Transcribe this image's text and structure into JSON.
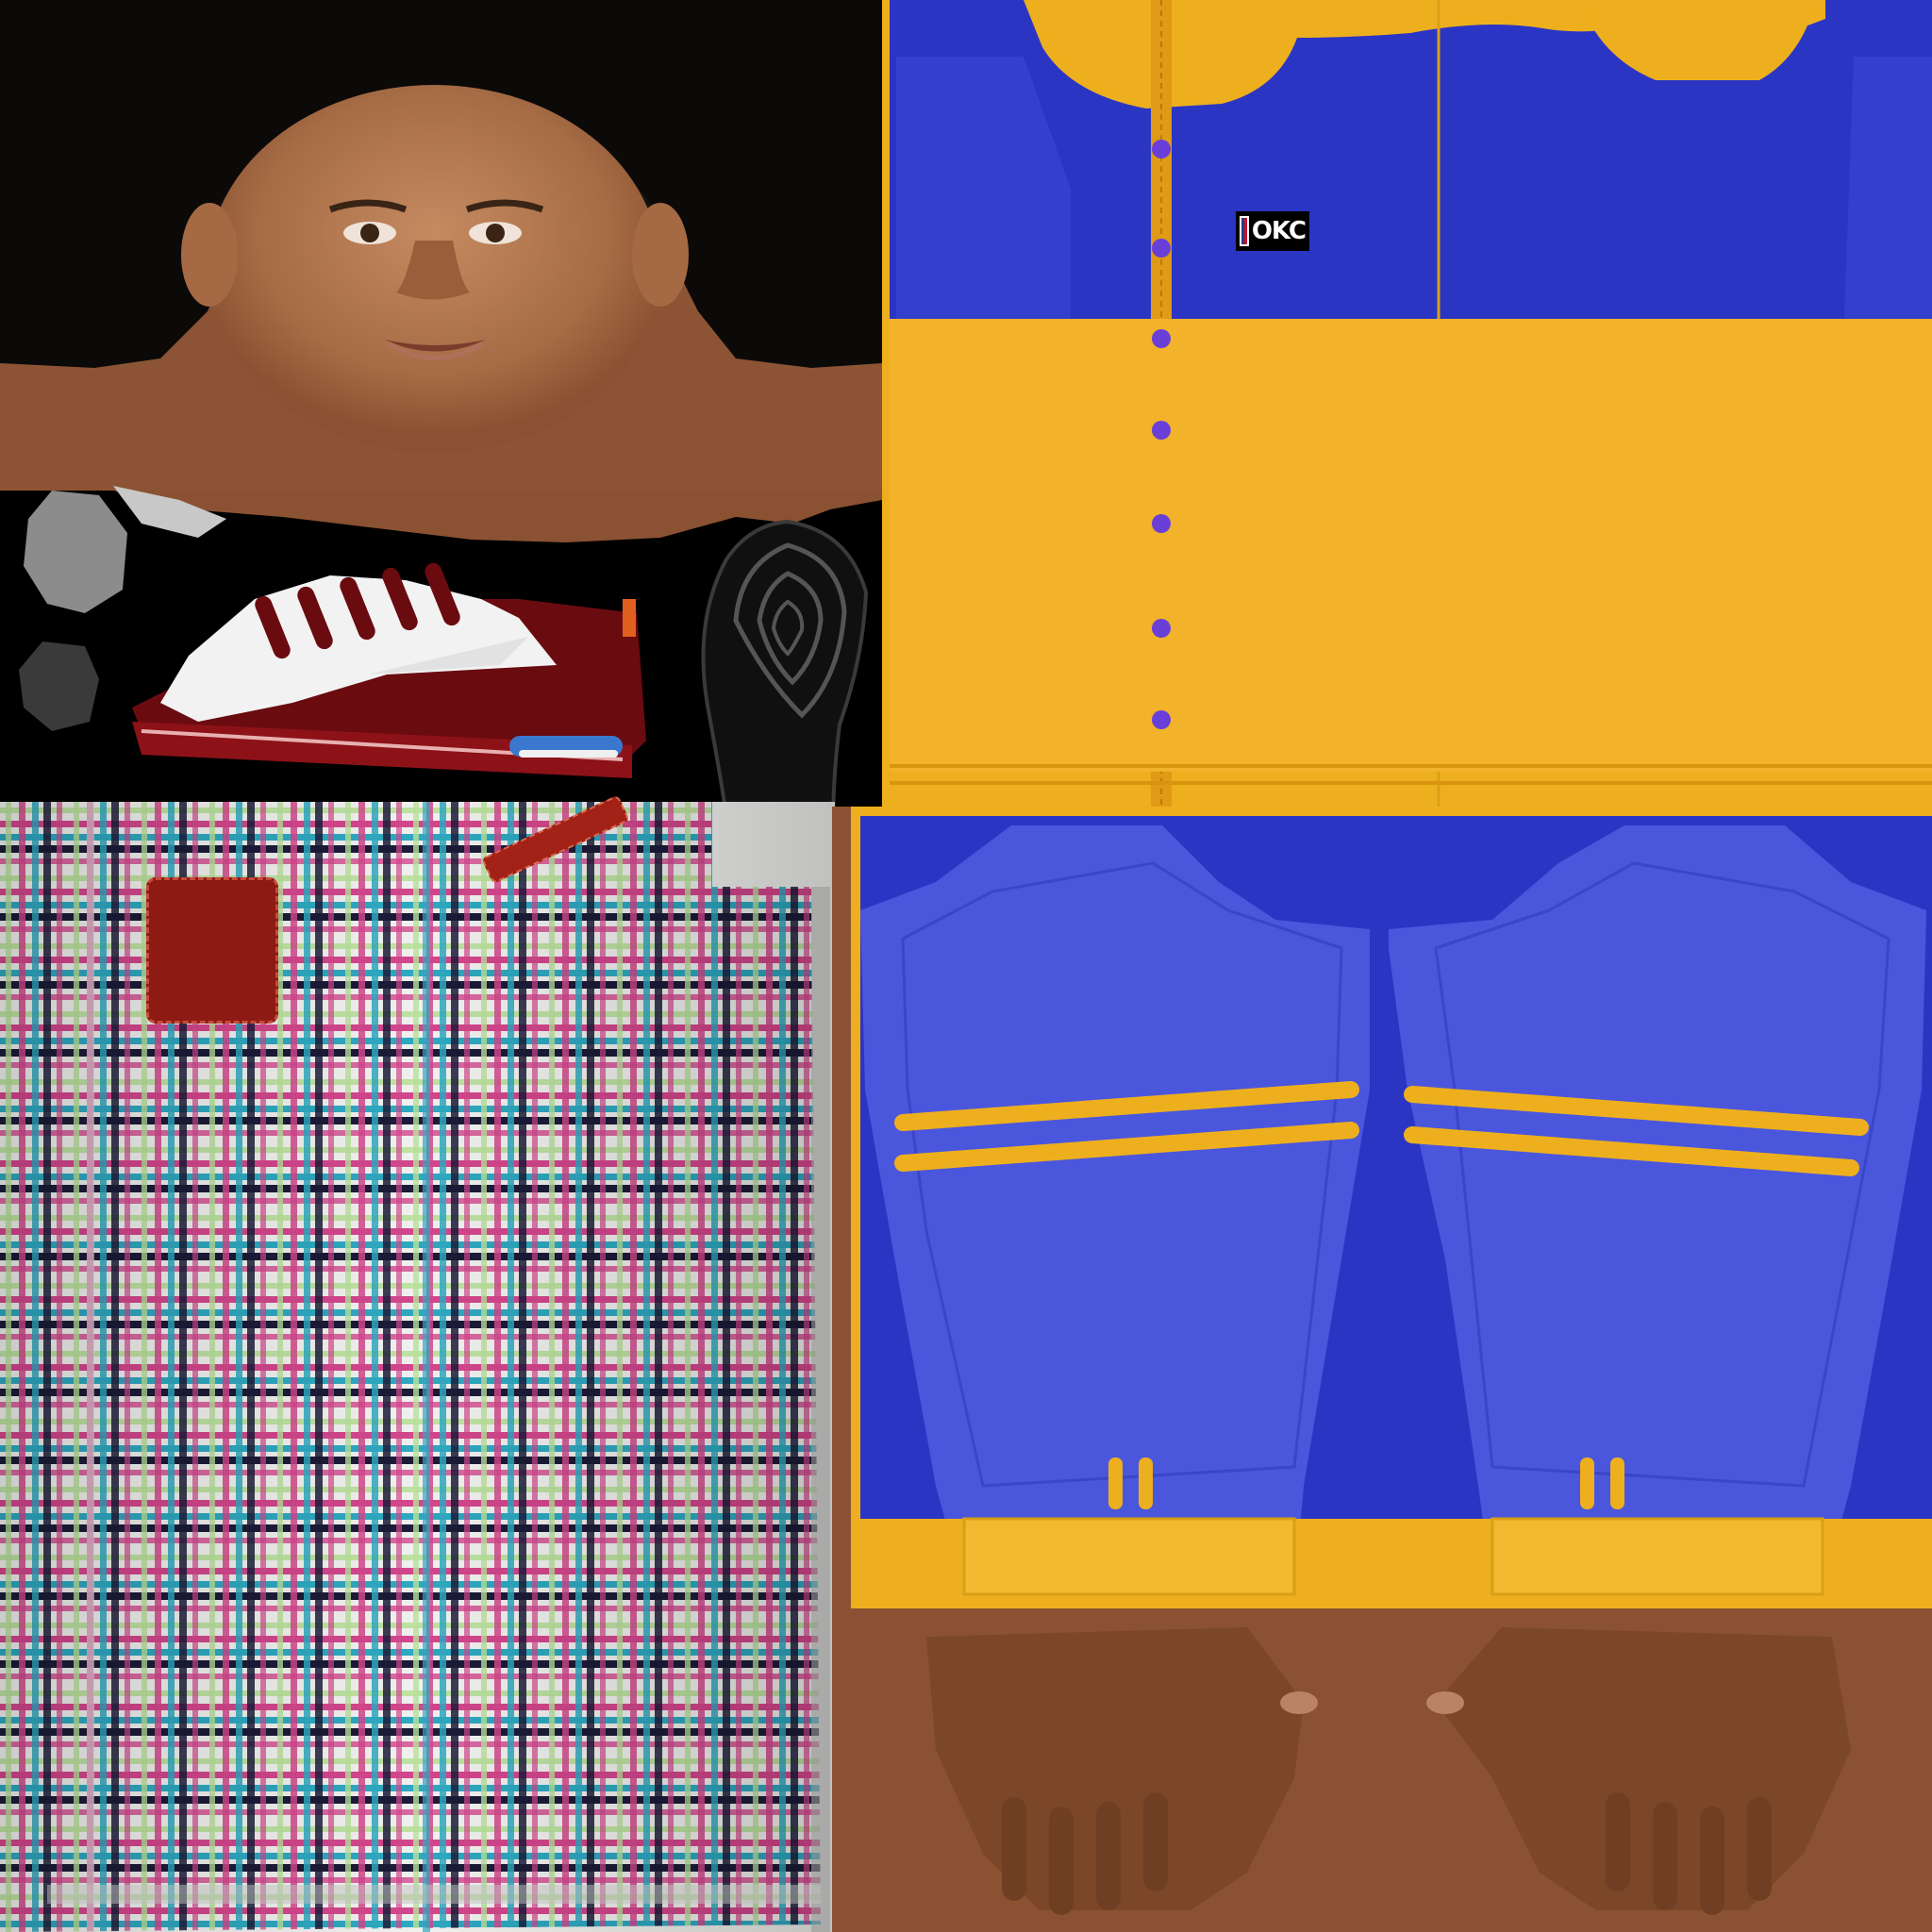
{
  "atlas": {
    "logo": {
      "league_mark": "nba-logo",
      "team_text": "OKC"
    },
    "colors": {
      "background": "#000000",
      "skin": "#8a5232",
      "skin_light": "#b77a52",
      "hair": "#0b0908",
      "jersey_blue": "#2b35c4",
      "jersey_blue_light": "#4a57dc",
      "jersey_gold": "#eeaf1e",
      "button_purple": "#6a3fd8",
      "shoe_maroon": "#6a0b10",
      "shoe_white": "#f2f2f2",
      "plaid_base": "#f0f0ee",
      "plaid_pink": "#d2468c",
      "plaid_teal": "#2ea8c0",
      "plaid_navy": "#1b1b38",
      "plaid_green": "#b8e09a",
      "pocket_red": "#8e1a14",
      "sole_yellow": "#e6dc1e"
    },
    "jersey_buttons": 7
  }
}
